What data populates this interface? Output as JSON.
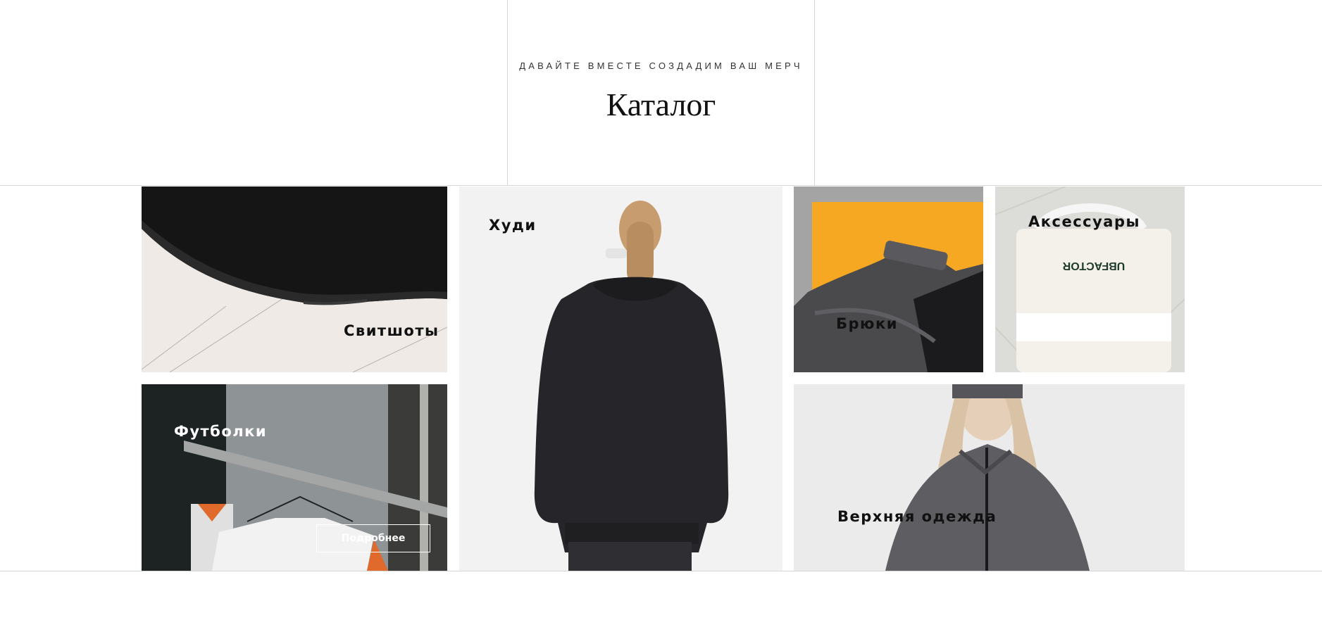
{
  "hero": {
    "subtitle": "ДАВАЙТЕ ВМЕСТЕ СОЗДАДИМ ВАШ МЕРЧ",
    "title": "Каталог"
  },
  "cards": {
    "sweatshirts": {
      "label": "Свитшоты"
    },
    "hoodies": {
      "label": "Худи"
    },
    "pants": {
      "label": "Брюки"
    },
    "accessories": {
      "label": "Аксессуары"
    },
    "tshirts": {
      "label": "Футболки",
      "button": "Подробнее"
    },
    "outerwear": {
      "label": "Верхняя одежда"
    }
  },
  "bag_print": "UBFACTOR",
  "colors": {
    "text": "#111111",
    "divider": "#d6d6d6",
    "accent_orange": "#f7a823"
  }
}
